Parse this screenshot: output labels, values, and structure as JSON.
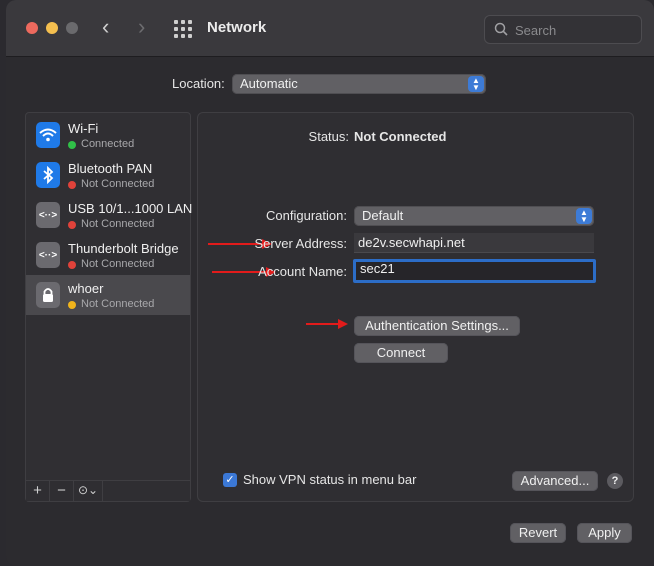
{
  "window": {
    "title": "Network",
    "search_placeholder": "Search"
  },
  "location": {
    "label": "Location:",
    "value": "Automatic"
  },
  "services": [
    {
      "name": "Wi-Fi",
      "status": "Connected",
      "status_color": "#30c048",
      "icon": "wifi-icon"
    },
    {
      "name": "Bluetooth PAN",
      "status": "Not Connected",
      "status_color": "#e0423a",
      "icon": "bluetooth-icon"
    },
    {
      "name": "USB 10/1...1000 LAN",
      "status": "Not Connected",
      "status_color": "#e0423a",
      "icon": "ethernet-icon"
    },
    {
      "name": "Thunderbolt Bridge",
      "status": "Not Connected",
      "status_color": "#e0423a",
      "icon": "ethernet-icon"
    },
    {
      "name": "whoer",
      "status": "Not Connected",
      "status_color": "#f0b41c",
      "icon": "lock-icon",
      "selected": true
    }
  ],
  "sidebar_footer": {
    "add": "+",
    "remove": "−",
    "actions": "⊙⌄"
  },
  "detail": {
    "status_label": "Status:",
    "status_value": "Not Connected",
    "configuration_label": "Configuration:",
    "configuration_value": "Default",
    "server_label": "Server Address:",
    "server_value": "de2v.secwhapi.net",
    "account_label": "Account Name:",
    "account_value": "sec21",
    "auth_button": "Authentication Settings...",
    "connect_button": "Connect",
    "show_vpn_label": "Show VPN status in menu bar",
    "show_vpn_checked": true,
    "advanced_button": "Advanced...",
    "help": "?"
  },
  "footer": {
    "revert": "Revert",
    "apply": "Apply"
  },
  "colors": {
    "accent": "#3b78d6",
    "annotation_arrow": "#e21b1b"
  }
}
